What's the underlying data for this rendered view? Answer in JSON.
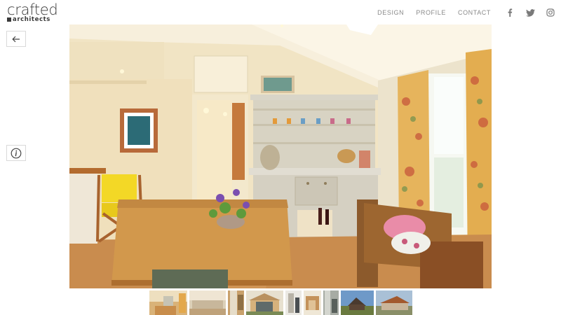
{
  "brand": {
    "name": "crafted",
    "sub": "architects"
  },
  "nav": {
    "links": [
      {
        "label": "DESIGN"
      },
      {
        "label": "PROFILE"
      },
      {
        "label": "CONTACT"
      }
    ],
    "social": [
      "facebook-icon",
      "twitter-icon",
      "instagram-icon"
    ]
  },
  "controls": {
    "back_icon": "arrow-left-icon",
    "info_icon": "info-icon"
  },
  "gallery": {
    "main_image": "kitchen dining room with farmhouse dresser",
    "thumbnail_count": 9
  },
  "colors": {
    "text": "#3a3a3a",
    "nav": "#8a8a8a",
    "border": "#d9d9d9"
  }
}
